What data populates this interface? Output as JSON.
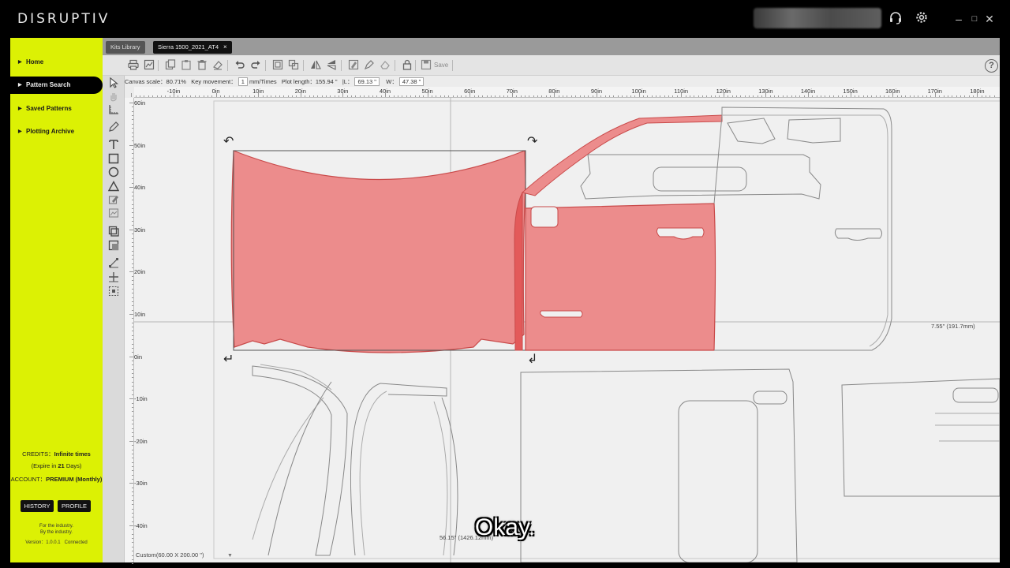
{
  "app": {
    "title": "DISRUPTIV"
  },
  "window": {
    "minimize": "–",
    "maximize": "□",
    "close": "✕"
  },
  "sidebar": {
    "items": [
      {
        "label": "Home",
        "active": false
      },
      {
        "label": "Pattern Search",
        "active": true
      },
      {
        "label": "Saved Patterns",
        "active": false
      },
      {
        "label": "Plotting Archive",
        "active": false
      }
    ],
    "credits_label": "CREDITS：",
    "credits_value": "Infinite times",
    "expire_prefix": "(Expire in",
    "expire_days": "21",
    "expire_suffix": "Days)",
    "account_label": "ACCOUNT：",
    "account_value": "PREMIUM (Monthly)",
    "history_button": "HISTORY",
    "profile_button": "PROFILE",
    "tagline_1": "For the industry.",
    "tagline_2": "By the industry.",
    "version": "Version：1.0.0.1",
    "connection": "Connected",
    "accent_color": "#dcf104"
  },
  "tabs": {
    "library": "Kits Library",
    "active": "Sierra 1500_2021_AT4",
    "close": "×"
  },
  "toolbar": {
    "save_label": "Save",
    "help": "?",
    "icons": [
      "print-icon",
      "preview-icon",
      "copy-icon",
      "paste-icon",
      "delete-icon",
      "clear-icon",
      "undo-icon",
      "redo-icon",
      "group-icon",
      "ungroup-icon",
      "flip-horizontal-icon",
      "flip-vertical-icon",
      "edit-node-icon",
      "pen-tool-icon",
      "eraser-icon",
      "lock-icon",
      "save-icon"
    ]
  },
  "status": {
    "canvas_scale_label": "Canvas scale：",
    "canvas_scale_value": "80.71%",
    "key_movement_label": "Key movement：",
    "key_movement_value": "1",
    "key_movement_unit": "mm/Times",
    "plot_length_label": "Plot length：",
    "plot_length_value": "155.94 \"",
    "l_label": "|L：",
    "l_value": "69.13 \"",
    "w_label": "W：",
    "w_value": "47.38 \""
  },
  "rulers": {
    "x_labels": [
      "-10in",
      "0in",
      "10in",
      "20in",
      "30in",
      "40in",
      "50in",
      "60in",
      "70in",
      "80in",
      "90in",
      "100in",
      "110in",
      "120in",
      "130in",
      "140in",
      "150in",
      "160in",
      "170in",
      "180in"
    ],
    "y_labels": [
      "60in",
      "50in",
      "40in",
      "30in",
      "20in",
      "10in",
      "0in",
      "-10in",
      "-20in",
      "-30in",
      "-40in"
    ]
  },
  "canvas": {
    "dimension_right": "7.55\" (191.7mm)",
    "dimension_bottom": "56.15\" (1426.12mm)",
    "material": "Custom(60.00 X 200.00 \")",
    "selection_color": "#ec8c8c"
  },
  "subtitle": "Okay."
}
